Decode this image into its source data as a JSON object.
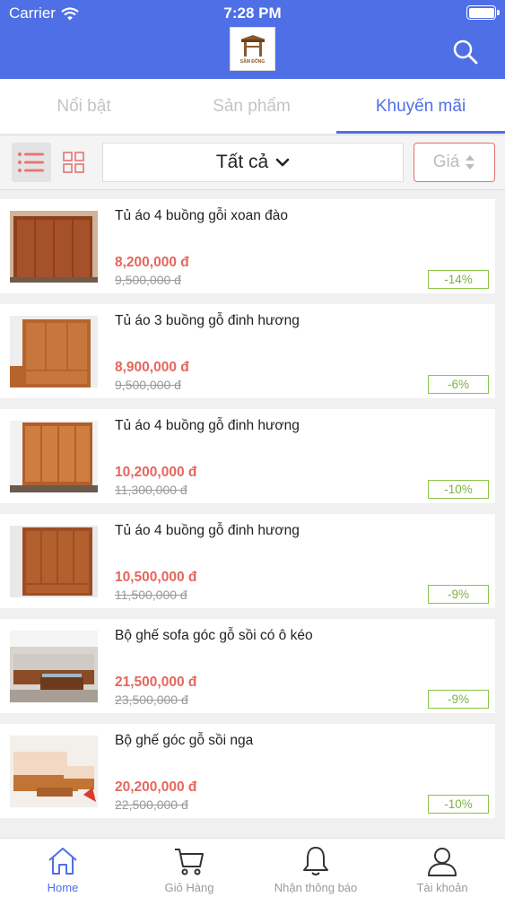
{
  "status_bar": {
    "carrier": "Carrier",
    "time": "7:28 PM"
  },
  "header": {
    "logo_text": "SÂM ĐÔNG",
    "search_icon": "search-icon"
  },
  "tabs": [
    {
      "label": "Nổi bật",
      "active": false
    },
    {
      "label": "Sản phẩm",
      "active": false
    },
    {
      "label": "Khuyến mãi",
      "active": true
    }
  ],
  "toolbar": {
    "filter_label": "Tất cả",
    "sort_label": "Giá",
    "view_mode": "list"
  },
  "products": [
    {
      "name": "Tủ áo 4 buồng gỗi xoan đào",
      "price": "8,200,000 đ",
      "old_price": "9,500,000 đ",
      "discount": "-14%"
    },
    {
      "name": "Tủ áo 3 buồng gỗ đinh hương",
      "price": "8,900,000 đ",
      "old_price": "9,500,000 đ",
      "discount": "-6%"
    },
    {
      "name": "Tủ áo 4 buồng gỗ đinh hương",
      "price": "10,200,000 đ",
      "old_price": "11,300,000 đ",
      "discount": "-10%"
    },
    {
      "name": "Tủ áo 4 buồng gỗ đinh hương",
      "price": "10,500,000 đ",
      "old_price": "11,500,000 đ",
      "discount": "-9%"
    },
    {
      "name": "Bộ ghế sofa góc gỗ sồi có ô kéo",
      "price": "21,500,000 đ",
      "old_price": "23,500,000 đ",
      "discount": "-9%"
    },
    {
      "name": "Bộ ghế góc gỗ sồi  nga",
      "price": "20,200,000 đ",
      "old_price": "22,500,000 đ",
      "discount": "-10%"
    }
  ],
  "bottom_nav": [
    {
      "label": "Home",
      "icon": "home-icon",
      "active": true
    },
    {
      "label": "Giỏ Hàng",
      "icon": "cart-icon",
      "active": false
    },
    {
      "label": "Nhận thông báo",
      "icon": "bell-icon",
      "active": false
    },
    {
      "label": "Tài khoản",
      "icon": "user-icon",
      "active": false
    }
  ],
  "colors": {
    "primary": "#4f6fe6",
    "price": "#e5665c",
    "discount": "#7cb342",
    "sort_border": "#e57373"
  }
}
